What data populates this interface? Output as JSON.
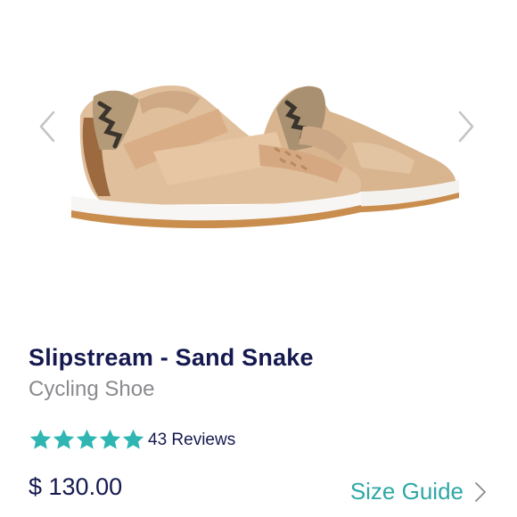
{
  "product": {
    "title": "Slipstream - Sand Snake",
    "subtitle": "Cycling Shoe",
    "reviews_label": "43 Reviews",
    "rating": 5,
    "price": "$ 130.00"
  },
  "actions": {
    "size_guide_label": "Size Guide"
  },
  "icons": {
    "prev": "chevron-left-icon",
    "next": "chevron-right-icon",
    "star": "star-icon",
    "size_guide_arrow": "chevron-right-icon"
  },
  "colors": {
    "title": "#15194f",
    "subtitle": "#8a8a8f",
    "star": "#2fb6b2",
    "accent": "#2fa8a5",
    "arrow": "#c4c4c6"
  }
}
